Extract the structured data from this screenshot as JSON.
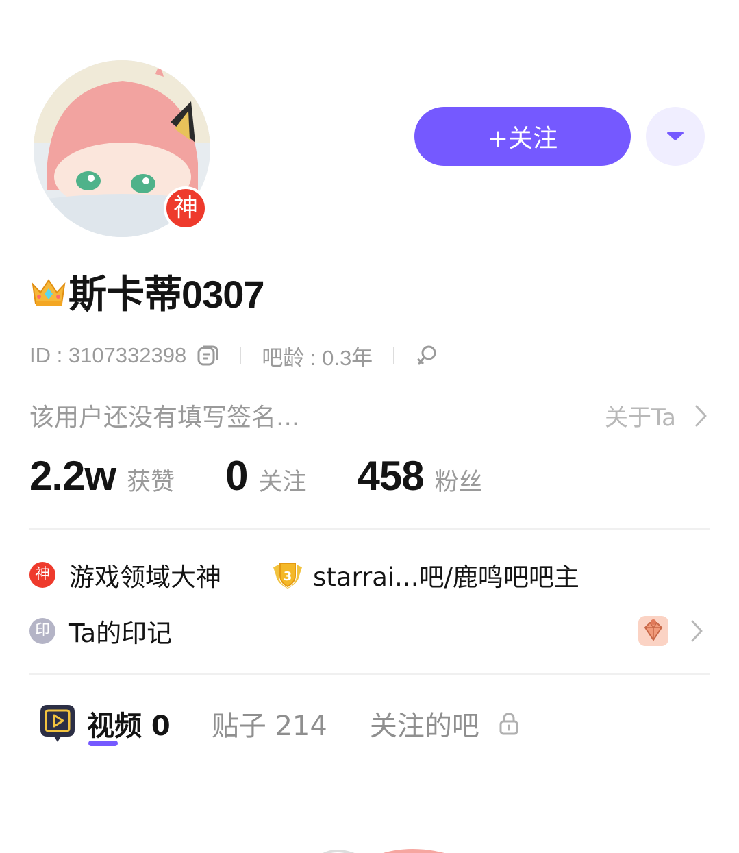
{
  "profile": {
    "god_badge": "神",
    "username": "斯卡蒂0307",
    "follow_label": "+关注",
    "id_text": "ID : 3107332398",
    "age_text": "吧龄 : 0.3年",
    "bio": "该用户还没有填写签名...",
    "about_label": "关于Ta"
  },
  "stats": [
    {
      "num": "2.2w",
      "label": "获赞"
    },
    {
      "num": "0",
      "label": "关注"
    },
    {
      "num": "458",
      "label": "粉丝"
    }
  ],
  "honors": {
    "game_icon": "神",
    "game_label": "游戏领域大神",
    "bar_level": "3",
    "bar_label": "starrai...吧/鹿鸣吧吧主"
  },
  "marks": {
    "icon": "印",
    "label": "Ta的印记"
  },
  "tabs": [
    {
      "label": "视频 0"
    },
    {
      "label": "贴子 214"
    },
    {
      "label": "关注的吧"
    }
  ],
  "colors": {
    "accent": "#7559ff",
    "god_red": "#ee3a2c",
    "secondary_text": "#9a9a9a"
  }
}
